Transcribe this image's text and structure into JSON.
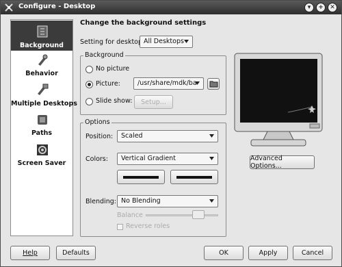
{
  "titlebar": {
    "title": "Configure - Desktop"
  },
  "sidebar": {
    "items": [
      {
        "label": "Background",
        "icon": "background-icon"
      },
      {
        "label": "Behavior",
        "icon": "behavior-icon"
      },
      {
        "label": "Multiple Desktops",
        "icon": "multiple-desktops-icon"
      },
      {
        "label": "Paths",
        "icon": "paths-icon"
      },
      {
        "label": "Screen Saver",
        "icon": "screen-saver-icon"
      }
    ]
  },
  "main": {
    "heading": "Change the background settings",
    "setting_for_desktop_label": "Setting for desktop:",
    "desktop_select": "All Desktops",
    "background_group": {
      "title": "Background",
      "no_picture": "No picture",
      "picture": "Picture:",
      "picture_path": "/usr/share/mdk/ba",
      "slide_show": "Slide show:",
      "setup_button": "Setup..."
    },
    "options_group": {
      "title": "Options",
      "position_label": "Position:",
      "position_value": "Scaled",
      "colors_label": "Colors:",
      "colors_value": "Vertical Gradient",
      "blending_label": "Blending:",
      "blending_value": "No Blending",
      "balance_label": "Balance",
      "reverse_roles_label": "Reverse roles"
    },
    "advanced_options_button": "Advanced Options..."
  },
  "footer": {
    "help": "Help",
    "defaults": "Defaults",
    "ok": "OK",
    "apply": "Apply",
    "cancel": "Cancel"
  }
}
